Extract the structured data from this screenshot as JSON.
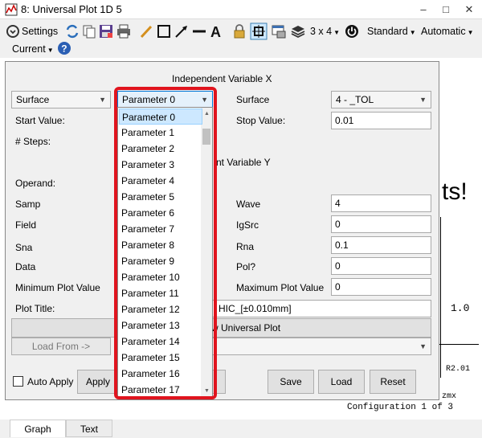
{
  "window": {
    "title": "8: Universal Plot 1D 5",
    "minimize": "–",
    "maximize": "□",
    "close": "✕"
  },
  "toolbar": {
    "settings": "Settings",
    "layout": "3 x 4",
    "standard": "Standard",
    "automatic": "Automatic",
    "current": "Current"
  },
  "dialog": {
    "indep_x_header": "Independent Variable X",
    "indep_y_header_partial": "nt Variable Y",
    "surface_combo": "Surface",
    "parameter_combo": "Parameter 0",
    "surface_label_right": "Surface",
    "surface_value_right": "4 -       _TOL",
    "start_value_label": "Start Value:",
    "stop_value_label": "Stop Value:",
    "stop_value": "0.01",
    "steps_label": "# Steps:",
    "operand_label": "Operand:",
    "samp_label": "Samp",
    "field_label": "Field",
    "sna_label": "Sna",
    "data_label": "Data",
    "min_plot_label": "Minimum Plot Value",
    "plot_title_label": "Plot Title:",
    "wave_label": "Wave",
    "wave_value": "4",
    "igsrc_label": "IgSrc",
    "igsrc_value": "0",
    "rna_label": "Rna",
    "rna_value": "0.1",
    "pol_label": "Pol?",
    "pol_value": "0",
    "max_plot_label": "Maximum Plot Value",
    "max_plot_value": "0",
    "plot_title_value_partial": "HIC_[±0.010mm]",
    "universal_plot_partial": "w Universal Plot",
    "load_from": "Load From ->",
    "auto_apply": "Auto Apply",
    "apply": "Apply",
    "save": "Save",
    "load": "Load",
    "reset": "Reset"
  },
  "dropdown_items": [
    "Parameter 0",
    "Parameter 1",
    "Parameter 2",
    "Parameter 3",
    "Parameter 4",
    "Parameter 5",
    "Parameter 6",
    "Parameter 7",
    "Parameter 8",
    "Parameter 9",
    "Parameter 10",
    "Parameter 11",
    "Parameter 12",
    "Parameter 13",
    "Parameter 14",
    "Parameter 15",
    "Parameter 16",
    "Parameter 17"
  ],
  "background_plot": {
    "big_text": "ts!",
    "axis_tick": "1.0",
    "rev_text": "R2.01",
    "file_text": "zmx",
    "config_text": "Configuration 1 of 3"
  },
  "tabs": [
    "Graph",
    "Text"
  ],
  "colors": {
    "highlight": "#e0141e",
    "selected": "#cde8ff"
  }
}
